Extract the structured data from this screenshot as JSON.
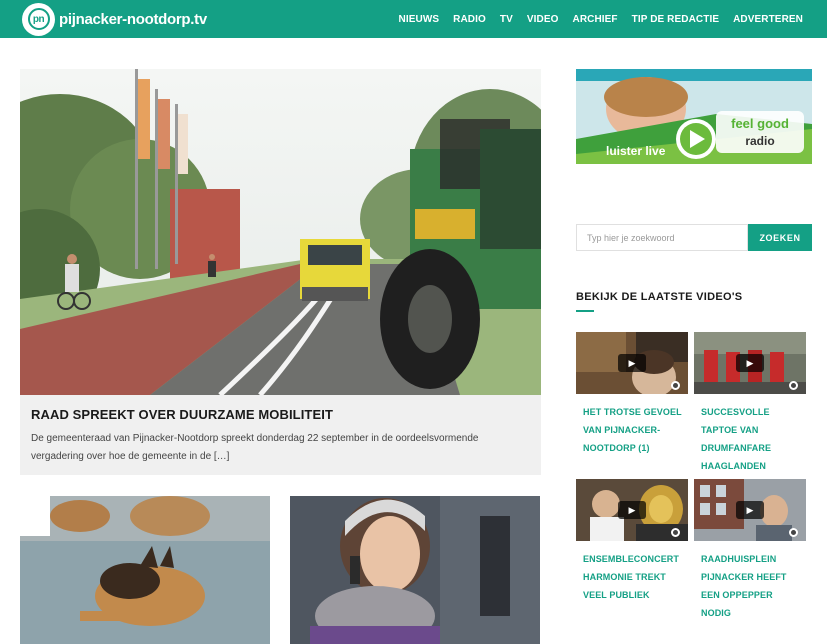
{
  "site": {
    "logo_badge": "pn",
    "logo_text": "pijnacker-nootdorp.tv"
  },
  "nav": [
    {
      "label": "NIEUWS"
    },
    {
      "label": "RADIO"
    },
    {
      "label": "TV"
    },
    {
      "label": "VIDEO"
    },
    {
      "label": "ARCHIEF"
    },
    {
      "label": "TIP DE REDACTIE"
    },
    {
      "label": "ADVERTEREN"
    }
  ],
  "featured": {
    "title": "RAAD SPREEKT OVER DUURZAME MOBILITEIT",
    "excerpt": "De gemeenteraad van Pijnacker-Nootdorp spreekt donderdag 22 september in de oordeelsvormende vergadering over hoe de gemeente in de […]"
  },
  "banner": {
    "brand_line1": "feel good",
    "brand_line2": "radio",
    "cta": "luister live"
  },
  "search": {
    "placeholder": "Typ hier je zoekwoord",
    "button": "ZOEKEN"
  },
  "videos": {
    "heading": "BEKIJK DE LAATSTE VIDEO'S",
    "items": [
      {
        "title": "HET TROTSE GEVOEL VAN PIJNACKER-NOOTDORP (1)"
      },
      {
        "title": "SUCCESVOLLE TAPTOE VAN DRUMFANFARE HAAGLANDEN"
      },
      {
        "title": "ENSEMBLECONCERT HARMONIE TREKT VEEL PUBLIEK"
      },
      {
        "title": "RAADHUISPLEIN PIJNACKER HEEFT EEN OPPEPPER NODIG"
      }
    ]
  },
  "colors": {
    "accent": "#14a085"
  }
}
